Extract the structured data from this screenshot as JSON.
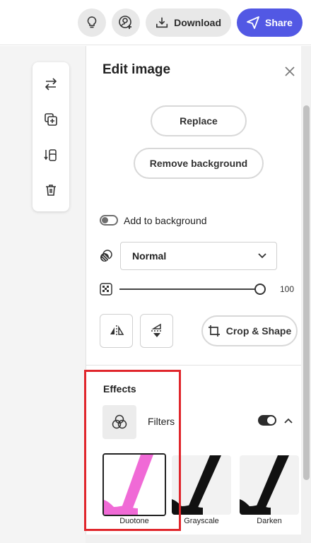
{
  "topbar": {
    "download_label": "Download",
    "share_label": "Share",
    "icons": [
      "lightbulb-icon",
      "add-user-icon",
      "download-icon",
      "share-send-icon"
    ],
    "share_color": "#5258e4"
  },
  "toolbox": {
    "tools": [
      "swap-icon",
      "duplicate-icon",
      "layers-icon",
      "trash-icon"
    ]
  },
  "panel": {
    "title": "Edit image",
    "replace_label": "Replace",
    "remove_background_label": "Remove background",
    "add_to_background_label": "Add to background",
    "add_to_background_on": false,
    "blend_mode": "Normal",
    "opacity_value": "100",
    "crop_label": "Crop & Shape"
  },
  "effects": {
    "title": "Effects",
    "filters_label": "Filters",
    "filters_enabled": true,
    "filters": [
      {
        "label": "Duotone",
        "selected": true
      },
      {
        "label": "Grayscale",
        "selected": false
      },
      {
        "label": "Darken",
        "selected": false
      }
    ]
  },
  "annotation": {
    "highlight_color": "#e0262c"
  }
}
